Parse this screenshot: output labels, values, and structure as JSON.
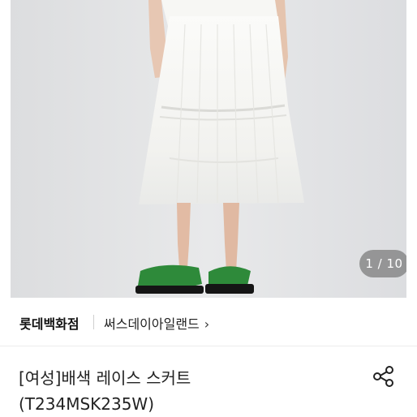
{
  "gallery": {
    "counter": "1 / 10",
    "current": 1,
    "total": 10
  },
  "brand": {
    "store_name": "롯데백화점",
    "shop_label": "써스데이아일랜드",
    "chevron": "›"
  },
  "product": {
    "title_line1": "[여성]배색 레이스 스커트",
    "title_line2": "(T234MSK235W)"
  },
  "icons": {
    "share": "share-icon",
    "chevron": "chevron-right-icon"
  },
  "colors": {
    "photo_bg": "#e4e5e7",
    "sandal_green": "#2e8a3a",
    "skirt_white": "#f7f7f4"
  }
}
